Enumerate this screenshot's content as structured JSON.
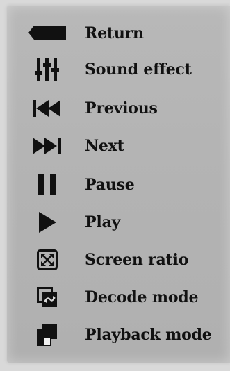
{
  "legend": {
    "items": [
      {
        "icon": "return-icon",
        "label": "Return"
      },
      {
        "icon": "sound-effect-icon",
        "label": "Sound effect"
      },
      {
        "icon": "previous-icon",
        "label": "Previous"
      },
      {
        "icon": "next-icon",
        "label": "Next"
      },
      {
        "icon": "pause-icon",
        "label": "Pause"
      },
      {
        "icon": "play-icon",
        "label": "Play"
      },
      {
        "icon": "screen-ratio-icon",
        "label": "Screen ratio"
      },
      {
        "icon": "decode-mode-icon",
        "label": "Decode mode"
      },
      {
        "icon": "playback-mode-icon",
        "label": "Playback mode"
      }
    ]
  }
}
